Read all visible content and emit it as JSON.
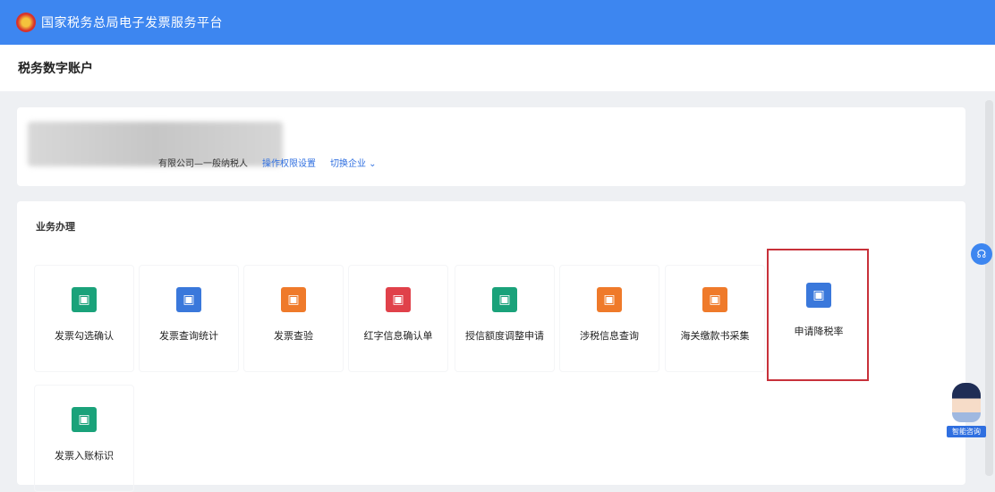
{
  "header": {
    "platform_title": "国家税务总局电子发票服务平台",
    "page_title": "税务数字账户"
  },
  "account": {
    "taxpayer_type": "有限公司—一般纳税人",
    "permission_link": "操作权限设置",
    "switch_link": "切换企业 ⌄"
  },
  "business": {
    "title": "业务办理",
    "items": [
      {
        "label": "发票勾选确认",
        "color": "#1aa27a",
        "icon": "ticket-icon"
      },
      {
        "label": "发票查询统计",
        "color": "#3a78db",
        "icon": "search-doc-icon"
      },
      {
        "label": "发票查验",
        "color": "#ef7a2a",
        "icon": "verify-icon"
      },
      {
        "label": "红字信息确认单",
        "color": "#e0414a",
        "icon": "red-doc-icon"
      },
      {
        "label": "授信额度调整申请",
        "color": "#1aa27a",
        "icon": "adjust-icon"
      },
      {
        "label": "涉税信息查询",
        "color": "#ef7a2a",
        "icon": "info-icon"
      },
      {
        "label": "海关缴款书采集",
        "color": "#ef7a2a",
        "icon": "customs-icon"
      },
      {
        "label": "申请降税率",
        "color": "#3a78db",
        "icon": "apply-icon"
      },
      {
        "label": "发票入账标识",
        "color": "#1aa27a",
        "icon": "account-icon"
      }
    ]
  },
  "assistant": {
    "label": "智能咨询"
  },
  "highlight_color": "#c8313a"
}
